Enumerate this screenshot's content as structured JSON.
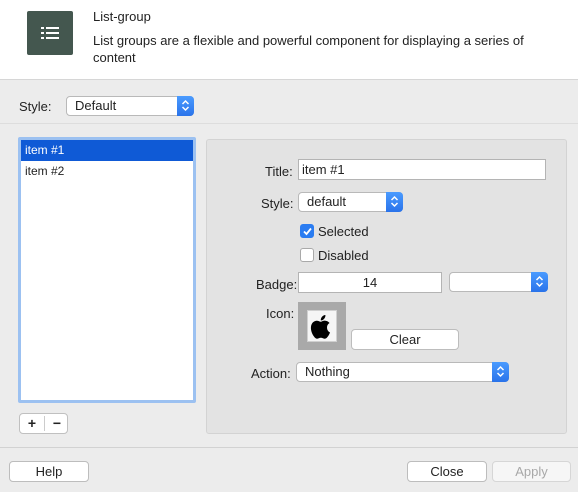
{
  "header": {
    "title": "List-group",
    "description": "List groups are a flexible and powerful component for displaying a series of content",
    "icon": "list-icon"
  },
  "top": {
    "style_label": "Style:",
    "style_value": "Default"
  },
  "list": {
    "items": [
      "item #1",
      "item #2"
    ],
    "selected_index": 0
  },
  "list_controls": {
    "add": "+",
    "remove": "−"
  },
  "detail": {
    "title_label": "Title:",
    "title_value": "item #1",
    "style_label": "Style:",
    "style_value": "default",
    "selected_label": "Selected",
    "selected_checked": true,
    "disabled_label": "Disabled",
    "disabled_checked": false,
    "badge_label": "Badge:",
    "badge_value": "14",
    "badge_style_value": "",
    "icon_label": "Icon:",
    "icon_name": "apple-icon",
    "clear_label": "Clear",
    "action_label": "Action:",
    "action_value": "Nothing"
  },
  "footer": {
    "help": "Help",
    "close": "Close",
    "apply": "Apply"
  },
  "colors": {
    "accent": "#2a73ea",
    "selection": "#0f5ad6",
    "header_icon_bg": "#44574f"
  }
}
